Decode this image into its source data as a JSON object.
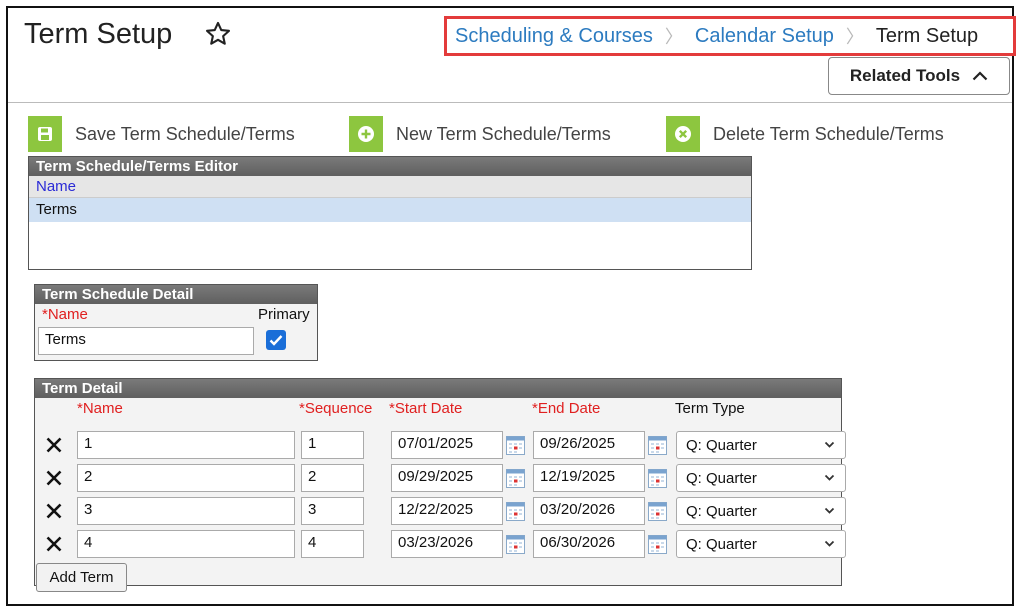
{
  "header": {
    "title": "Term Setup",
    "breadcrumb": [
      "Scheduling & Courses",
      "Calendar Setup",
      "Term Setup"
    ],
    "related_tools_label": "Related Tools"
  },
  "toolbar": {
    "save_label": "Save Term Schedule/Terms",
    "new_label": "New Term Schedule/Terms",
    "delete_label": "Delete Term Schedule/Terms"
  },
  "editor": {
    "title": "Term Schedule/Terms Editor",
    "column": "Name",
    "rows": [
      "Terms"
    ]
  },
  "schedule_detail": {
    "title": "Term Schedule Detail",
    "name_label": "*Name",
    "primary_label": "Primary",
    "name_value": "Terms",
    "primary_checked": true
  },
  "term_detail": {
    "title": "Term Detail",
    "headers": {
      "name": "*Name",
      "sequence": "*Sequence",
      "start": "*Start Date",
      "end": "*End Date",
      "type": "Term Type"
    },
    "rows": [
      {
        "name": "1",
        "sequence": "1",
        "start": "07/01/2025",
        "end": "09/26/2025",
        "type": "Q: Quarter"
      },
      {
        "name": "2",
        "sequence": "2",
        "start": "09/29/2025",
        "end": "12/19/2025",
        "type": "Q: Quarter"
      },
      {
        "name": "3",
        "sequence": "3",
        "start": "12/22/2025",
        "end": "03/20/2026",
        "type": "Q: Quarter"
      },
      {
        "name": "4",
        "sequence": "4",
        "start": "03/23/2026",
        "end": "06/30/2026",
        "type": "Q: Quarter"
      }
    ],
    "add_label": "Add Term"
  },
  "colors": {
    "accent_green": "#8dc63f",
    "link_blue": "#2c7bc0",
    "highlight_red": "#e33b3b",
    "required_red": "#e02020",
    "selected_row": "#cfe0f3"
  }
}
